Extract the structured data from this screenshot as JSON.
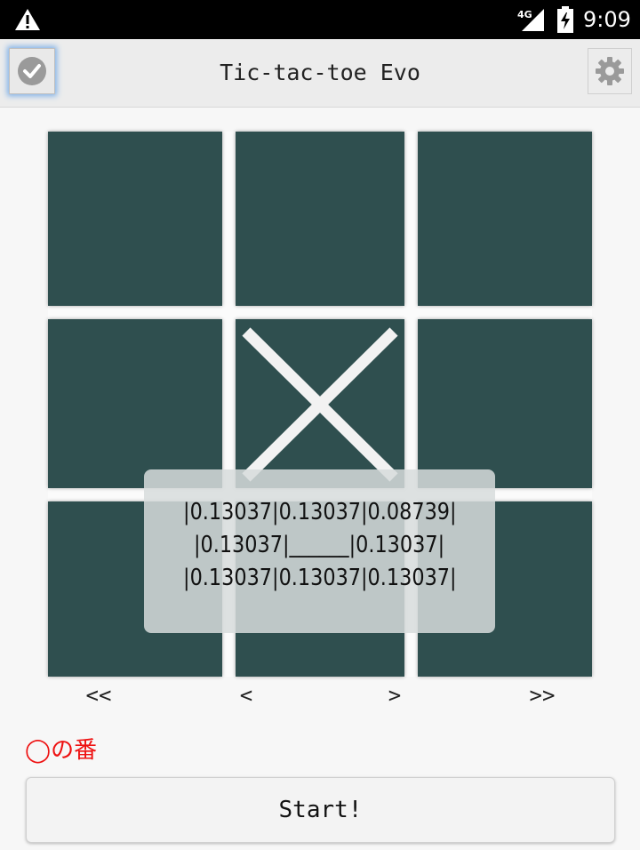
{
  "status_bar": {
    "network": "4G",
    "time": "9:09",
    "icons": [
      "warning-icon",
      "signal-icon",
      "battery-charging-icon"
    ]
  },
  "app_bar": {
    "title": "Tic-tac-toe Evo",
    "left_icon": "check-icon",
    "right_icon": "gear-icon"
  },
  "board": {
    "cells": [
      "",
      "",
      "",
      "",
      "X",
      "",
      "",
      "",
      ""
    ],
    "mark_color": "#f2f2f2",
    "cell_color": "#2f4f4f"
  },
  "toast": {
    "lines": [
      "|0.13037|0.13037|0.08739|",
      "|0.13037|______|0.13037|",
      "|0.13037|0.13037|0.13037|"
    ]
  },
  "nav": {
    "first": "<<",
    "prev": "<",
    "next": ">",
    "last": ">>"
  },
  "turn_label": "◯の番",
  "start_button": "Start!"
}
